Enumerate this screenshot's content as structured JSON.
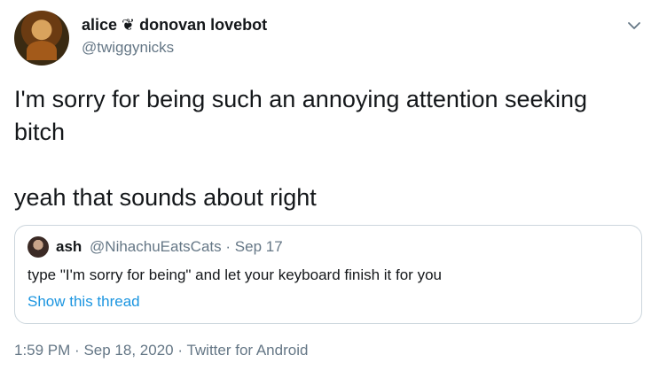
{
  "tweet": {
    "author": {
      "display_name": "alice ❦ donovan lovebot",
      "handle": "@twiggynicks"
    },
    "text": [
      "I'm sorry for being such an annoying attention seeking bitch",
      "yeah that sounds about right"
    ],
    "quoted": {
      "name": "ash",
      "handle": "@NihachuEatsCats",
      "separator": "·",
      "date": "Sep 17",
      "text": "type \"I'm sorry for being\" and let your keyboard finish it for you",
      "link": "Show this thread"
    },
    "meta": {
      "time": "1:59 PM",
      "separator1": "·",
      "date": "Sep 18, 2020",
      "separator2": "·",
      "source": "Twitter for Android"
    }
  },
  "icons": {
    "menu": "chevron-down-icon"
  },
  "colors": {
    "text": "#14171a",
    "secondary": "#657786",
    "link": "#1b95e0",
    "border": "#ccd6dd"
  }
}
